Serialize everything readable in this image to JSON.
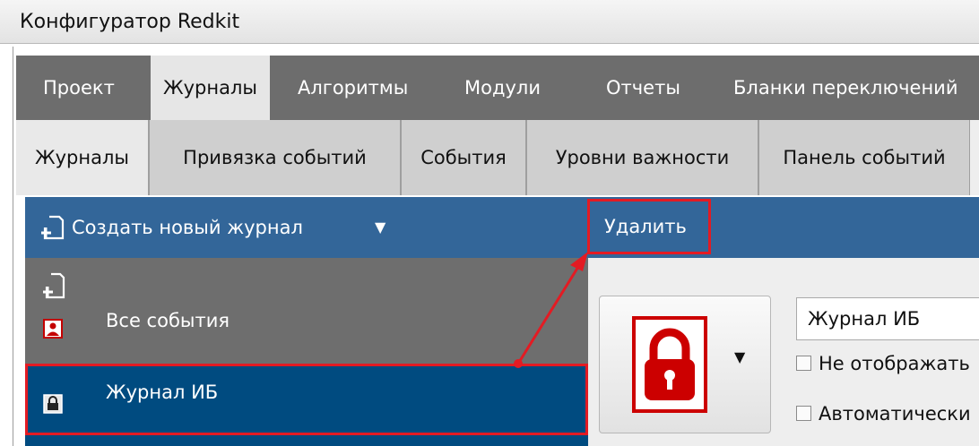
{
  "window": {
    "title": "Конфигуратор Redkit"
  },
  "main_menu": {
    "items": [
      {
        "label": "Проект"
      },
      {
        "label": "Журналы",
        "active": true
      },
      {
        "label": "Алгоритмы"
      },
      {
        "label": "Модули"
      },
      {
        "label": "Отчеты"
      },
      {
        "label": "Бланки переключений"
      }
    ]
  },
  "sub_tabs": {
    "items": [
      {
        "label": "Журналы",
        "active": true
      },
      {
        "label": "Привязка событий"
      },
      {
        "label": "События"
      },
      {
        "label": "Уровни важности"
      },
      {
        "label": "Панель событий"
      }
    ]
  },
  "toolbar": {
    "create_label": "Создать новый журнал",
    "create_icon": "new-document-icon",
    "dropdown_icon": "caret-down-icon",
    "delete_label": "Удалить"
  },
  "journals": {
    "items": [
      {
        "label": "Все события",
        "icon": "user-red-icon"
      },
      {
        "label": "Журнал ИБ",
        "icon": "lock-icon",
        "selected": true
      }
    ]
  },
  "details": {
    "icon": "lock-red-icon",
    "name_value": "Журнал ИБ",
    "checkbox1_label": "Не отображать",
    "checkbox2_label": "Автоматически"
  },
  "colors": {
    "toolbar_bg": "#336699",
    "selected_bg": "#004b80",
    "highlight": "#e31b23",
    "menu_bg": "#6d6d6d"
  }
}
